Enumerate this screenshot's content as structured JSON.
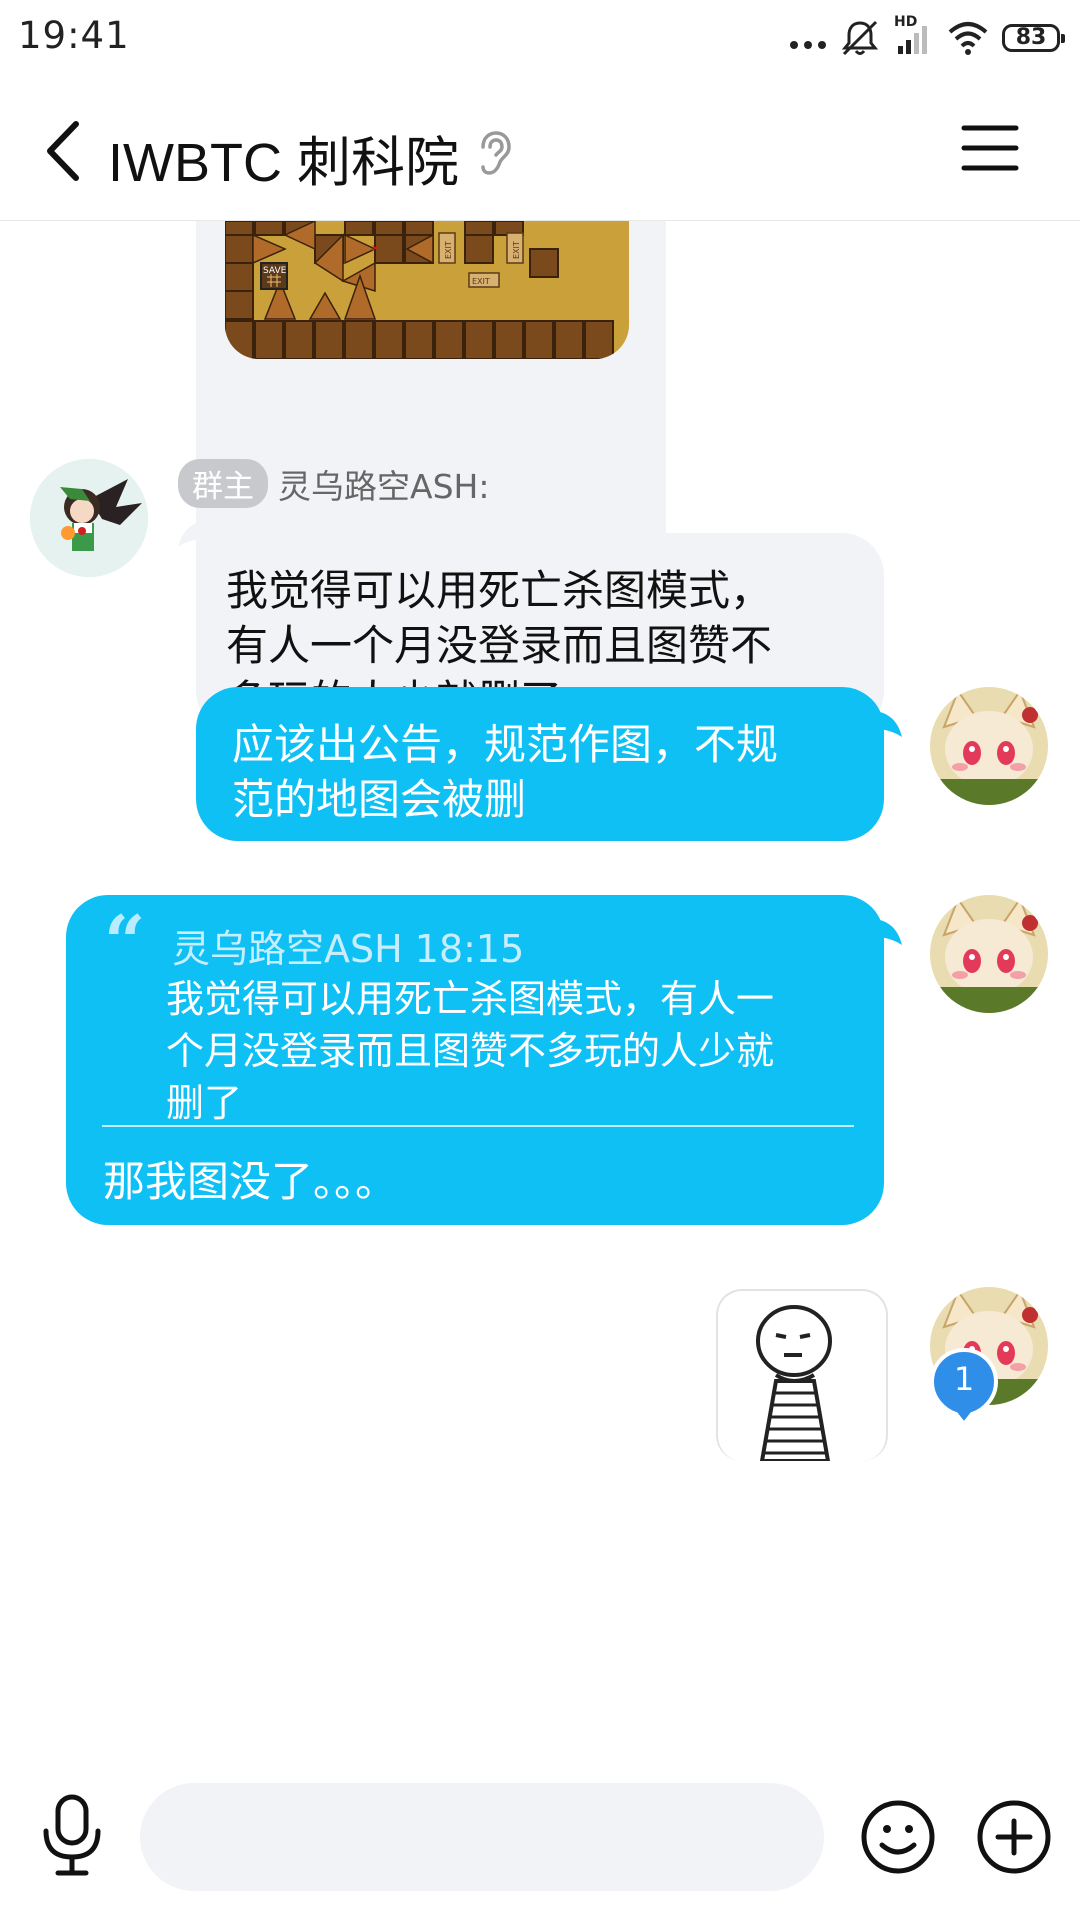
{
  "status_bar": {
    "time": "19:41",
    "battery": "83",
    "network_label": "HD"
  },
  "header": {
    "title": "IWBTC 刺科院"
  },
  "messages": [
    {
      "id": "m1",
      "type": "image",
      "direction": "incoming",
      "image_texts": [
        "SAVE",
        "EXIT",
        "EXIT",
        "EXIT"
      ]
    },
    {
      "id": "m2",
      "type": "text",
      "direction": "incoming",
      "badge": "群主",
      "sender": "灵乌路空ASH:",
      "lines": [
        "我觉得可以用死亡杀图模式，",
        "有人一个月没登录而且图赞不",
        "多玩的人少就删了"
      ]
    },
    {
      "id": "m3",
      "type": "text",
      "direction": "outgoing",
      "lines": [
        "应该出公告，规范作图，不规",
        "范的地图会被删"
      ]
    },
    {
      "id": "m4",
      "type": "reply",
      "direction": "outgoing",
      "quote_mark": "“",
      "quote_header": "灵乌路空ASH 18:15",
      "quote_lines": [
        "我觉得可以用死亡杀图模式，有人一",
        "个月没登录而且图赞不多玩的人少就",
        "删了"
      ],
      "text": "那我图没了。。。"
    },
    {
      "id": "m5",
      "type": "sticker",
      "direction": "outgoing"
    }
  ],
  "unread_count": "1",
  "input": {
    "placeholder": "",
    "value": ""
  },
  "colors": {
    "outgoing_bubble": "#0fc0f5",
    "incoming_bubble": "#f2f3f7",
    "badge": "#c8c9cc",
    "unread": "#2f8ee8"
  },
  "icons": [
    "dots-icon",
    "mute-icon",
    "signal-icon",
    "wifi-icon",
    "battery-icon",
    "back-icon",
    "ear-icon",
    "menu-icon",
    "mic-icon",
    "emoji-icon",
    "plus-icon"
  ]
}
